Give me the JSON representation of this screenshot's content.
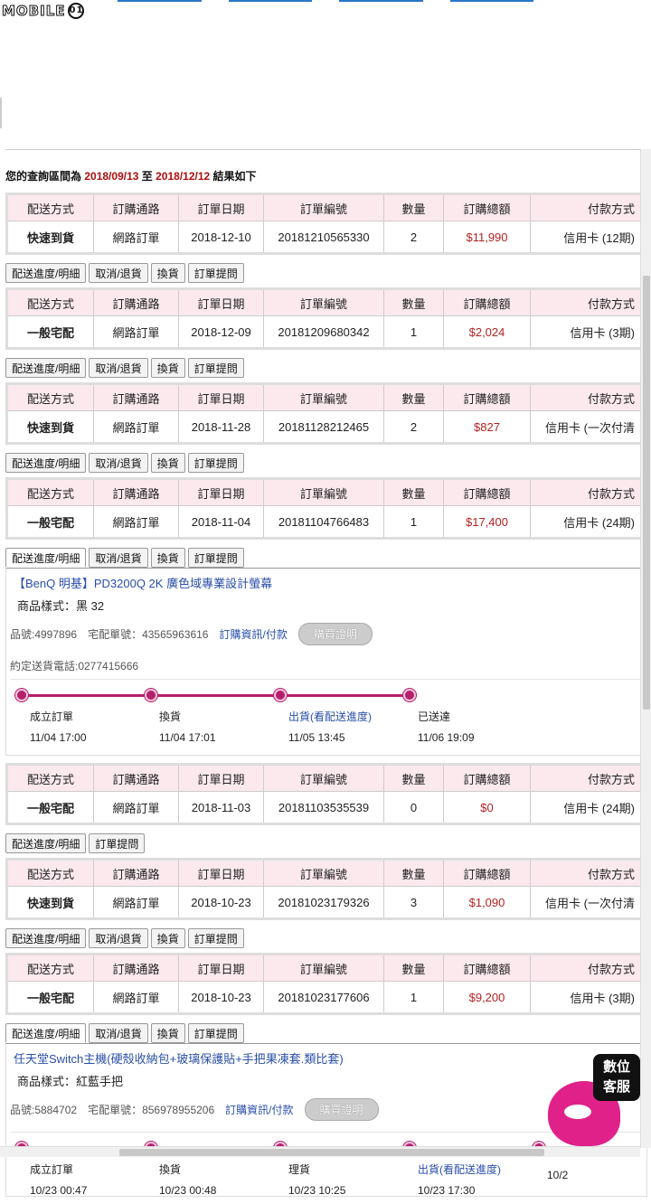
{
  "header": {
    "logo_text": "MOBILE",
    "logo_badge": "01"
  },
  "query": {
    "prefix": "您的查詢區間為",
    "start": "2018/09/13",
    "mid": "至",
    "end": "2018/12/12",
    "suffix": "結果如下"
  },
  "columns": [
    "配送方式",
    "訂購通路",
    "訂單日期",
    "訂單編號",
    "數量",
    "訂購總額",
    "付款方式"
  ],
  "orders": [
    {
      "ship": "快速到貨",
      "channel": "網路訂單",
      "date": "2018-12-10",
      "no": "20181210565330",
      "qty": "2",
      "total": "$11,990",
      "pay": "信用卡 (12期)",
      "buttons": [
        "配送進度/明細",
        "取消/退貨",
        "換貨",
        "訂單提問"
      ]
    },
    {
      "ship": "一般宅配",
      "channel": "網路訂單",
      "date": "2018-12-09",
      "no": "20181209680342",
      "qty": "1",
      "total": "$2,024",
      "pay": "信用卡 (3期)",
      "buttons": [
        "配送進度/明細",
        "取消/退貨",
        "換貨",
        "訂單提問"
      ]
    },
    {
      "ship": "快速到貨",
      "channel": "網路訂單",
      "date": "2018-11-28",
      "no": "20181128212465",
      "qty": "2",
      "total": "$827",
      "pay": "信用卡 (一次付清",
      "buttons": [
        "配送進度/明細",
        "取消/退貨",
        "換貨",
        "訂單提問"
      ]
    },
    {
      "ship": "一般宅配",
      "channel": "網路訂單",
      "date": "2018-11-04",
      "no": "20181104766483",
      "qty": "1",
      "total": "$17,400",
      "pay": "信用卡 (24期)",
      "buttons": [
        "配送進度/明細",
        "取消/退貨",
        "換貨",
        "訂單提問"
      ],
      "detail": {
        "product": "【BenQ 明基】PD3200Q 2K 廣色域專業設計螢幕",
        "style": "商品樣式：黑 32",
        "item_no": "品號:4997896",
        "track_no": "宅配單號：43565963616",
        "info_link": "訂購資訊/付款",
        "proof": "購買證明",
        "phone": "約定送貨電話:0277415666",
        "steps": [
          {
            "label": "成立訂單",
            "time": "11/04 17:00",
            "link": false
          },
          {
            "label": "換貨",
            "time": "11/04 17:01",
            "link": false
          },
          {
            "label": "出貨(看配送進度)",
            "time": "11/05 13:45",
            "link": true
          },
          {
            "label": "已送達",
            "time": "11/06 19:09",
            "link": false
          }
        ]
      }
    },
    {
      "ship": "一般宅配",
      "channel": "網路訂單",
      "date": "2018-11-03",
      "no": "20181103535539",
      "qty": "0",
      "total": "$0",
      "pay": "信用卡 (24期)",
      "buttons": [
        "配送進度/明細",
        "訂單提問"
      ]
    },
    {
      "ship": "快速到貨",
      "channel": "網路訂單",
      "date": "2018-10-23",
      "no": "20181023179326",
      "qty": "3",
      "total": "$1,090",
      "pay": "信用卡 (一次付清",
      "buttons": [
        "配送進度/明細",
        "取消/退貨",
        "換貨",
        "訂單提問"
      ]
    },
    {
      "ship": "一般宅配",
      "channel": "網路訂單",
      "date": "2018-10-23",
      "no": "20181023177606",
      "qty": "1",
      "total": "$9,200",
      "pay": "信用卡 (3期)",
      "buttons": [
        "配送進度/明細",
        "取消/退貨",
        "換貨",
        "訂單提問"
      ],
      "detail": {
        "product": "任天堂Switch主機(硬殼收納包+玻璃保護貼+手把果凍套.類比套)",
        "style": "商品樣式：紅藍手把",
        "item_no": "品號:5884702",
        "track_no": "宅配單號：856978955206",
        "info_link": "訂購資訊/付款",
        "proof": "購買證明",
        "phone": "",
        "steps": [
          {
            "label": "成立訂單",
            "time": "10/23 00:47",
            "link": false
          },
          {
            "label": "換貨",
            "time": "10/23 00:48",
            "link": false
          },
          {
            "label": "理貨",
            "time": "10/23 10:25",
            "link": false
          },
          {
            "label": "出貨(看配送進度)",
            "time": "10/23 17:30",
            "link": true
          },
          {
            "label": "",
            "time": "10/2",
            "link": false
          }
        ]
      }
    }
  ],
  "chat_widget": {
    "line1": "數位",
    "line2": "客服"
  }
}
